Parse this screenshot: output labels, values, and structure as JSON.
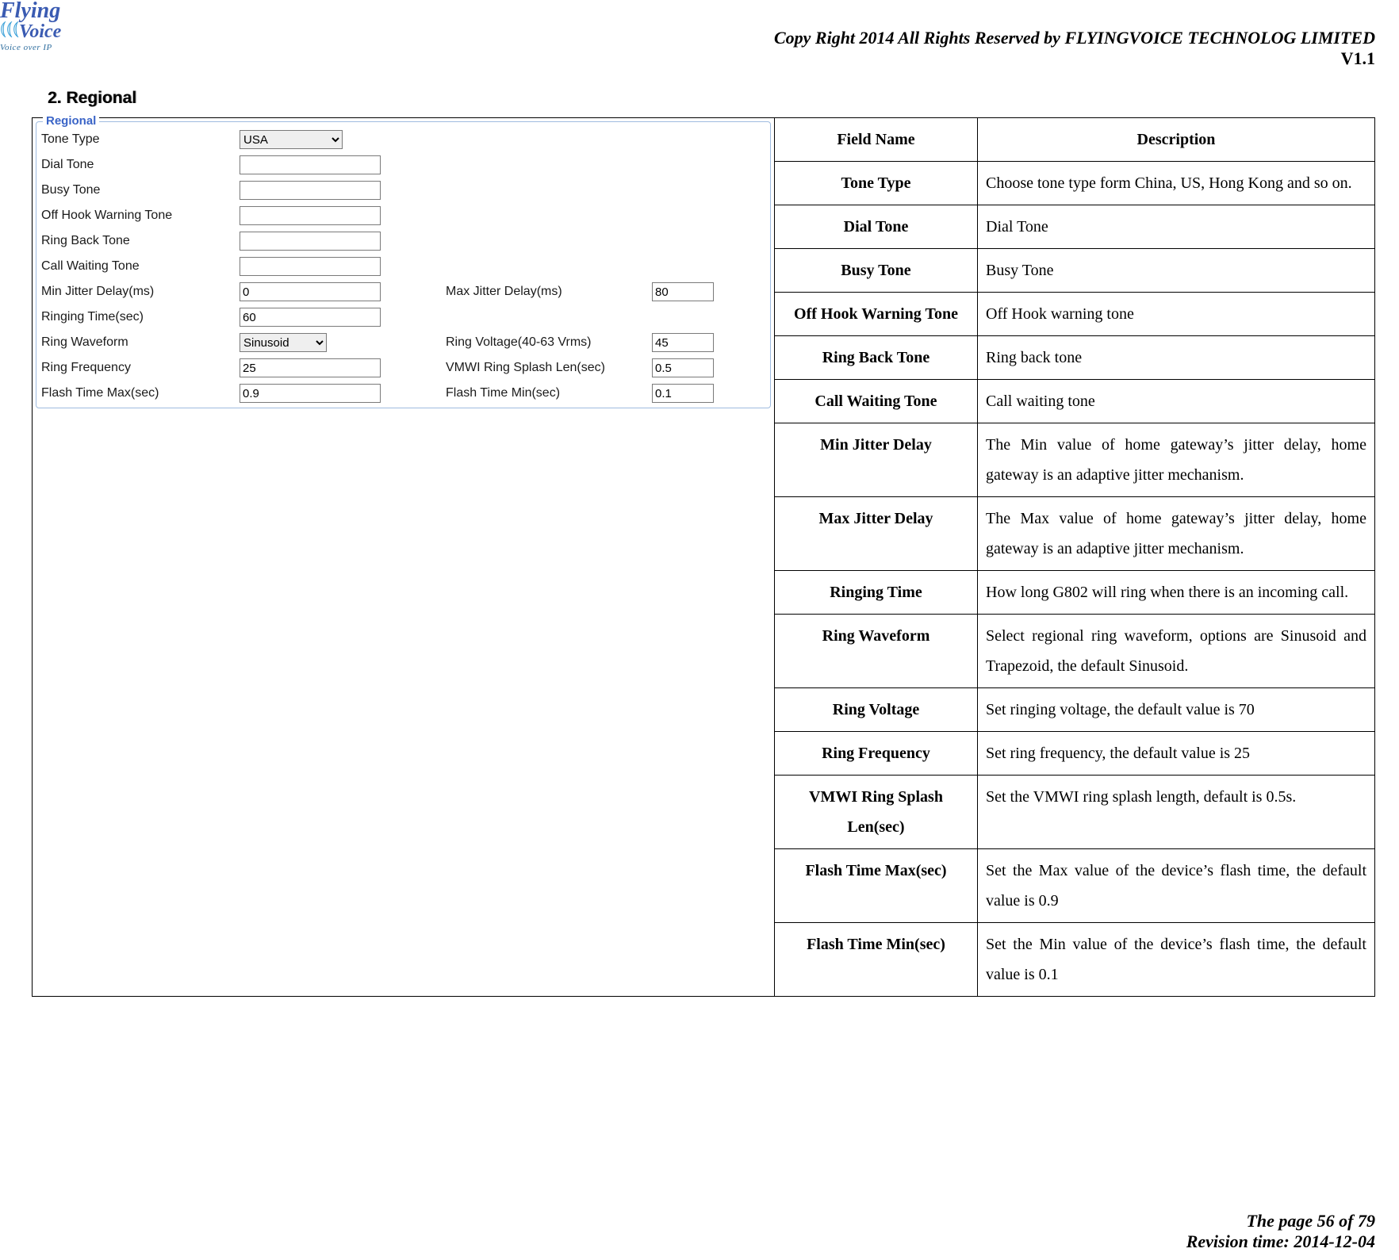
{
  "header": {
    "copyright": "Copy Right 2014 All Rights Reserved by FLYINGVOICE TECHNOLOG LIMITED",
    "version": "V1.1",
    "logo_main": "FlyingVoice",
    "logo_sub": "Voice over IP"
  },
  "section": {
    "title": "2.  Regional"
  },
  "screenshot": {
    "legend": "Regional",
    "fields": {
      "tone_type": {
        "label": "Tone Type",
        "value": "USA"
      },
      "dial_tone": {
        "label": "Dial Tone",
        "value": ""
      },
      "busy_tone": {
        "label": "Busy Tone",
        "value": ""
      },
      "off_hook": {
        "label": "Off Hook Warning Tone",
        "value": ""
      },
      "ring_back": {
        "label": "Ring Back Tone",
        "value": ""
      },
      "call_waiting": {
        "label": "Call Waiting Tone",
        "value": ""
      },
      "min_jitter": {
        "label": "Min Jitter Delay(ms)",
        "value": "0"
      },
      "max_jitter": {
        "label": "Max Jitter Delay(ms)",
        "value": "80"
      },
      "ringing_time": {
        "label": "Ringing Time(sec)",
        "value": "60"
      },
      "ring_waveform": {
        "label": "Ring Waveform",
        "value": "Sinusoid"
      },
      "ring_voltage": {
        "label": "Ring Voltage(40-63 Vrms)",
        "value": "45"
      },
      "ring_frequency": {
        "label": "Ring Frequency",
        "value": "25"
      },
      "vmwi": {
        "label": "VMWI Ring Splash Len(sec)",
        "value": "0.5"
      },
      "flash_max": {
        "label": "Flash Time Max(sec)",
        "value": "0.9"
      },
      "flash_min": {
        "label": "Flash Time Min(sec)",
        "value": "0.1"
      }
    }
  },
  "table": {
    "head": {
      "field": "Field Name",
      "desc": "Description"
    },
    "rows": [
      {
        "field": "Tone Type",
        "desc": "Choose tone type form China, US, Hong Kong and so on."
      },
      {
        "field": "Dial Tone",
        "desc": "Dial Tone"
      },
      {
        "field": "Busy Tone",
        "desc": "Busy Tone"
      },
      {
        "field": "Off Hook Warning Tone",
        "desc": "Off Hook warning tone"
      },
      {
        "field": "Ring Back Tone",
        "desc": "Ring back tone"
      },
      {
        "field": "Call Waiting Tone",
        "desc": "Call waiting tone"
      },
      {
        "field": "Min Jitter Delay",
        "desc": "The Min value of home gateway’s jitter delay, home gateway is an adaptive jitter mechanism."
      },
      {
        "field": "Max Jitter Delay",
        "desc": "The Max value of home gateway’s jitter delay, home gateway is an adaptive jitter mechanism."
      },
      {
        "field": "Ringing Time",
        "desc": "How long G802 will ring when there is an incoming call."
      },
      {
        "field": "Ring Waveform",
        "desc": "Select regional ring waveform, options are Sinusoid and Trapezoid, the default Sinusoid."
      },
      {
        "field": "Ring Voltage",
        "desc": "Set ringing voltage, the default value is 70"
      },
      {
        "field": "Ring Frequency",
        "desc": "Set ring frequency, the default value is 25"
      },
      {
        "field": "VMWI Ring Splash Len(sec)",
        "desc": "Set the VMWI ring splash length, default is 0.5s."
      },
      {
        "field": "Flash Time Max(sec)",
        "desc": "Set the Max value of the device’s flash time, the default value is 0.9"
      },
      {
        "field": "Flash Time Min(sec)",
        "desc": "Set the Min value of the device’s flash time, the default value is 0.1"
      }
    ]
  },
  "footer": {
    "page": "The page 56 of 79",
    "rev": "Revision time: 2014-12-04"
  }
}
